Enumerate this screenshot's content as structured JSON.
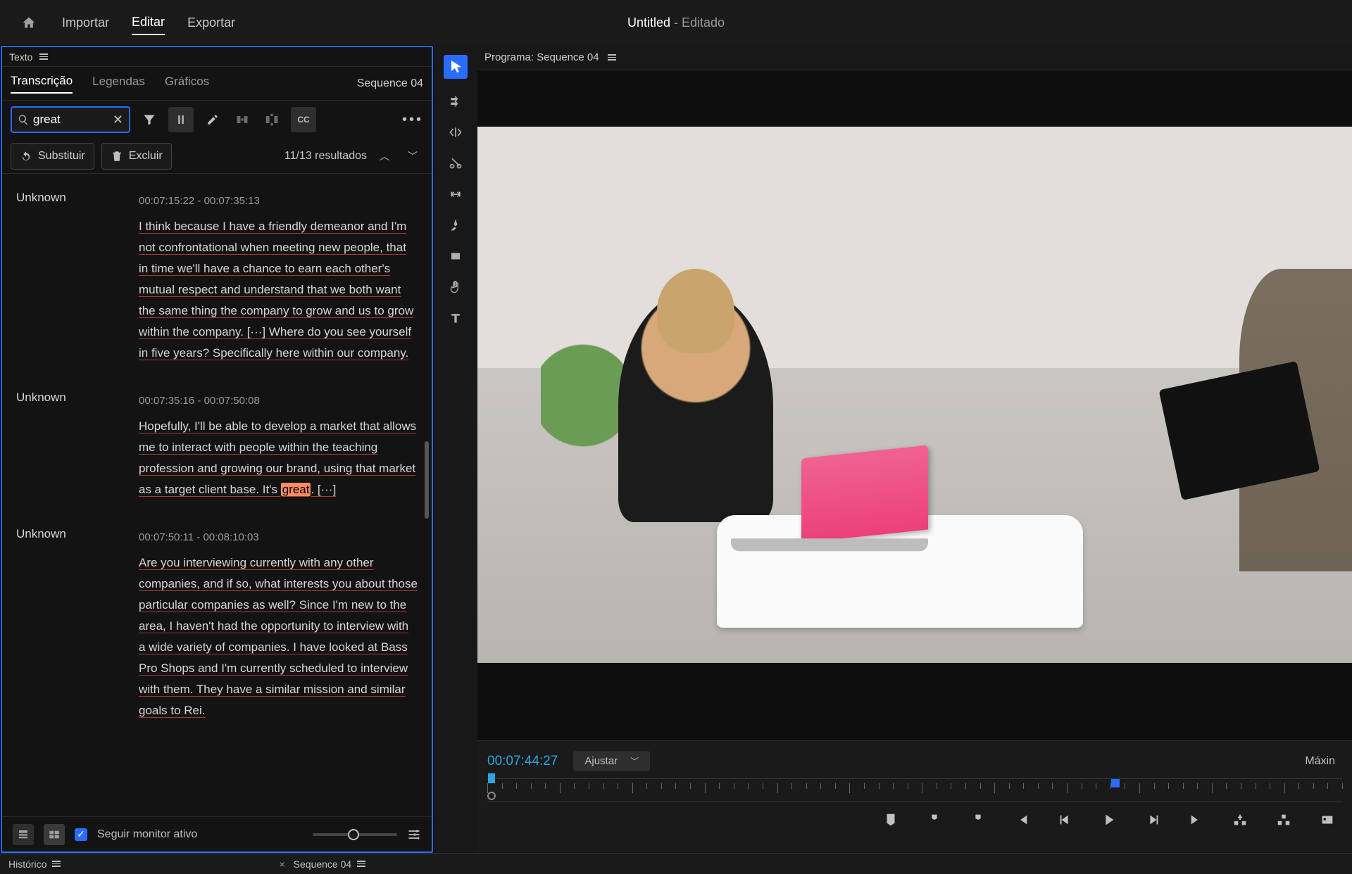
{
  "header": {
    "tabs": {
      "import": "Importar",
      "edit": "Editar",
      "export": "Exportar"
    },
    "title": "Untitled",
    "title_suffix": " - Editado"
  },
  "text_panel": {
    "panel_label": "Texto",
    "tabs": {
      "transcription": "Transcrição",
      "captions": "Legendas",
      "graphics": "Gráficos"
    },
    "sequence_label": "Sequence 04",
    "search_value": "great",
    "replace_label": "Substituir",
    "delete_label": "Excluir",
    "results_label": "11/13 resultados",
    "follow_label": "Seguir monitor ativo",
    "segments": [
      {
        "speaker": "Unknown",
        "timecode": "00:07:15:22 - 00:07:35:13",
        "text": "I think because I have a friendly demeanor and I'm not confrontational when meeting new people, that in time we'll have a chance to earn each other's mutual respect and understand that we both want the same thing the company to grow and us to grow within the company. [···] Where do you see yourself in five years? Specifically here within our company."
      },
      {
        "speaker": "Unknown",
        "timecode": "00:07:35:16 - 00:07:50:08",
        "text_pre": "Hopefully, I'll be able to develop a market that allows me to interact with people within the teaching profession and growing our brand, using that market as a target client base. It's ",
        "highlight": "great",
        "text_post": ". [···]"
      },
      {
        "speaker": "Unknown",
        "timecode": "00:07:50:11 - 00:08:10:03",
        "text": "Are you interviewing currently with any other companies, and if so, what interests you about those particular companies as well? Since I'm new to the area, I haven't had the opportunity to interview with a wide variety of companies. I have looked at Bass Pro Shops and I'm currently scheduled to interview with them. They have a similar mission and similar goals to Rei."
      }
    ]
  },
  "program_monitor": {
    "label": "Programa: Sequence 04",
    "timecode": "00:07:44:27",
    "fit_label": "Ajustar",
    "max_label": "Máxin"
  },
  "bottom_tabs": {
    "history": "Histórico",
    "sequence": "Sequence 04"
  }
}
